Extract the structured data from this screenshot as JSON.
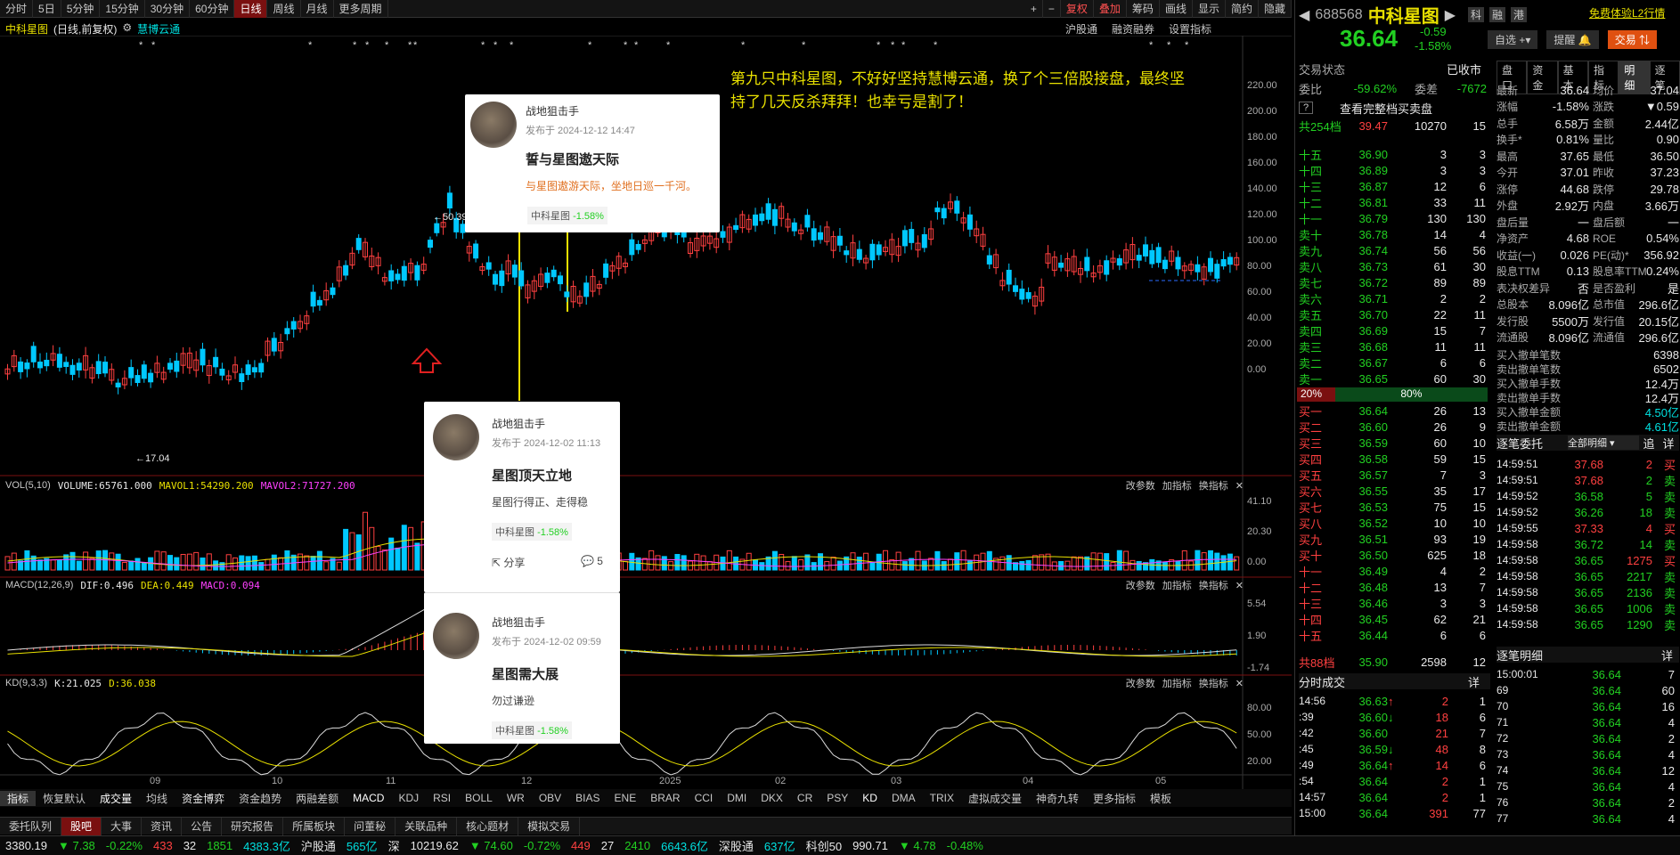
{
  "topbar": {
    "tabs": [
      "分时",
      "5日",
      "5分钟",
      "15分钟",
      "30分钟",
      "60分钟",
      "日线",
      "周线",
      "月线",
      "更多周期"
    ],
    "right": [
      "复权",
      "叠加",
      "筹码",
      "画线",
      "显示",
      "简约",
      "隐藏"
    ]
  },
  "chart_header": {
    "title": "中科星图",
    "sub": "(日线,前复权)",
    "overlay": "慧博云通",
    "right": [
      "沪股通",
      "融资融券",
      "设置指标"
    ]
  },
  "annotation": "第九只中科星图，不好好坚持慧博云通，换了个三倍股接盘，最终坚持了几天反杀拜拜！也幸亏是割了！",
  "price_marks": {
    "high": "50.39",
    "low": "17.04"
  },
  "price_axis": [
    "220.00",
    "200.00",
    "180.00",
    "160.00",
    "140.00",
    "120.00",
    "100.00",
    "80.00",
    "60.00",
    "40.00",
    "20.00",
    "0.00"
  ],
  "vol": {
    "label": "VOL(5,10)",
    "volume": "VOLUME:65761.000",
    "ma1": "MAVOL1:54290.200",
    "ma2": "MAVOL2:71727.200",
    "axis": [
      "41.10",
      "20.30",
      "0.00"
    ],
    "tools": [
      "改参数",
      "加指标",
      "换指标"
    ]
  },
  "macd": {
    "label": "MACD(12,26,9)",
    "dif": "DIF:0.496",
    "dea": "DEA:0.449",
    "macd": "MACD:0.094",
    "axis": [
      "5.54",
      "1.90",
      "-1.74"
    ]
  },
  "kd": {
    "label": "KD(9,3,3)",
    "k": "K:21.025",
    "d": "D:36.038",
    "axis": [
      "80.00",
      "50.00",
      "20.00"
    ]
  },
  "xaxis": [
    "09",
    "10",
    "11",
    "12",
    "2025",
    "02",
    "03",
    "04",
    "05"
  ],
  "indicator_bar": [
    "指标",
    "恢复默认",
    "成交量",
    "均线",
    "资金博弈",
    "资金趋势",
    "两融差额",
    "MACD",
    "KDJ",
    "RSI",
    "BOLL",
    "WR",
    "OBV",
    "BIAS",
    "ENE",
    "BRAR",
    "CCI",
    "DMI",
    "DKX",
    "CR",
    "PSY",
    "KD",
    "DMA",
    "TRIX",
    "虚拟成交量",
    "神奇九转",
    "更多指标",
    "模板"
  ],
  "bottom_tabs": [
    "委托队列",
    "股吧",
    "大事",
    "资讯",
    "公告",
    "研究报告",
    "所属板块",
    "问董秘",
    "关联品种",
    "核心题材",
    "模拟交易"
  ],
  "cards": [
    {
      "author": "战地狙击手",
      "date": "发布于 2024-12-12 14:47",
      "title": "誓与星图遨天际",
      "body": "与星图遨游天际，坐地日巡一千河。",
      "tag": "中科星图",
      "chg": "-1.58%"
    },
    {
      "author": "战地狙击手",
      "date": "发布于 2024-12-02 11:13",
      "title": "星图顶天立地",
      "body": "星图行得正、走得稳",
      "tag": "中科星图",
      "chg": "-1.58%",
      "share": "分享",
      "comments": "5"
    },
    {
      "author": "战地狙击手",
      "date": "发布于 2024-12-02 09:59",
      "title": "星图需大展",
      "body": "勿过谦逊",
      "tag": "中科星图",
      "chg": "-1.58%"
    }
  ],
  "quote": {
    "code": "688568",
    "name": "中科星图",
    "price": "36.64",
    "chg": "-0.59",
    "pct": "-1.58%",
    "btns": [
      "自选",
      "提醒",
      "交易"
    ],
    "top_right": [
      "科",
      "融",
      "港"
    ],
    "l2": "免费体验L2行情",
    "tabs": [
      "盘口",
      "资金",
      "基本",
      "指标",
      "明细",
      "逐笔"
    ],
    "state": "交易状态",
    "state_val": "已收市",
    "ratio": [
      "委比",
      "-59.62%",
      "委差",
      "-7672"
    ],
    "full": "查看完整档买卖盘",
    "sum": [
      "共254档",
      "39.47",
      "10270",
      "15"
    ],
    "asks": [
      [
        "十五",
        "36.90",
        "3",
        "3"
      ],
      [
        "十四",
        "36.89",
        "3",
        "3"
      ],
      [
        "十三",
        "36.87",
        "12",
        "6"
      ],
      [
        "十二",
        "36.81",
        "33",
        "11"
      ],
      [
        "十一",
        "36.79",
        "130",
        "130"
      ],
      [
        "卖十",
        "36.78",
        "14",
        "4"
      ],
      [
        "卖九",
        "36.74",
        "56",
        "56"
      ],
      [
        "卖八",
        "36.73",
        "61",
        "30"
      ],
      [
        "卖七",
        "36.72",
        "89",
        "89"
      ],
      [
        "卖六",
        "36.71",
        "2",
        "2"
      ],
      [
        "卖五",
        "36.70",
        "22",
        "11"
      ],
      [
        "卖四",
        "36.69",
        "15",
        "7"
      ],
      [
        "卖三",
        "36.68",
        "11",
        "11"
      ],
      [
        "卖二",
        "36.67",
        "6",
        "6"
      ],
      [
        "卖一",
        "36.65",
        "60",
        "30"
      ]
    ],
    "bar": [
      "20%",
      "80%"
    ],
    "bids": [
      [
        "买一",
        "36.64",
        "26",
        "13"
      ],
      [
        "买二",
        "36.60",
        "26",
        "9"
      ],
      [
        "买三",
        "36.59",
        "60",
        "10"
      ],
      [
        "买四",
        "36.58",
        "59",
        "15"
      ],
      [
        "买五",
        "36.57",
        "7",
        "3"
      ],
      [
        "买六",
        "36.55",
        "35",
        "17"
      ],
      [
        "买七",
        "36.53",
        "75",
        "15"
      ],
      [
        "买八",
        "36.52",
        "10",
        "10"
      ],
      [
        "买九",
        "36.51",
        "93",
        "19"
      ],
      [
        "买十",
        "36.50",
        "625",
        "18"
      ],
      [
        "十一",
        "36.49",
        "4",
        "2"
      ],
      [
        "十二",
        "36.48",
        "13",
        "7"
      ],
      [
        "十三",
        "36.46",
        "3",
        "3"
      ],
      [
        "十四",
        "36.45",
        "62",
        "21"
      ],
      [
        "十五",
        "36.44",
        "6",
        "6"
      ]
    ],
    "bsum": [
      "共88档",
      "35.90",
      "2598",
      "12"
    ],
    "stats": [
      [
        "最新",
        "36.64",
        "均价",
        "37.04"
      ],
      [
        "涨幅",
        "-1.58%",
        "涨跌",
        "▼0.59"
      ],
      [
        "总手",
        "6.58万",
        "金额",
        "2.44亿"
      ],
      [
        "换手*",
        "0.81%",
        "量比",
        "0.90"
      ],
      [
        "最高",
        "37.65",
        "最低",
        "36.50"
      ],
      [
        "今开",
        "37.01",
        "昨收",
        "37.23"
      ],
      [
        "涨停",
        "44.68",
        "跌停",
        "29.78"
      ],
      [
        "外盘",
        "2.92万",
        "内盘",
        "3.66万"
      ],
      [
        "盘后量",
        "一",
        "盘后额",
        "一"
      ],
      [
        "净资产",
        "4.68",
        "ROE",
        "0.54%"
      ],
      [
        "收益(一)",
        "0.026",
        "PE(动)*",
        "356.92"
      ],
      [
        "股息TTM",
        "0.13",
        "股息率TTM",
        "0.24%"
      ],
      [
        "表决权差异",
        "否",
        "是否盈利",
        "是"
      ],
      [
        "总股本",
        "8.096亿",
        "总市值",
        "296.6亿"
      ],
      [
        "发行股",
        "5500万",
        "发行值",
        "20.15亿"
      ],
      [
        "流通股",
        "8.096亿",
        "流通值",
        "296.6亿"
      ]
    ],
    "cancel": [
      [
        "买入撤单笔数",
        "6398"
      ],
      [
        "卖出撤单笔数",
        "6502"
      ],
      [
        "买入撤单手数",
        "12.4万"
      ],
      [
        "卖出撤单手数",
        "12.4万"
      ],
      [
        "买入撤单金额",
        "4.50亿"
      ],
      [
        "卖出撤单金额",
        "4.61亿"
      ]
    ],
    "zb_title": "逐笔委托",
    "zb_sel": "全部明细",
    "zb_btns": [
      "追",
      "详"
    ],
    "zb": [
      [
        "14:59:51",
        "37.68",
        "2",
        "买"
      ],
      [
        "14:59:51",
        "37.68",
        "2",
        "卖"
      ],
      [
        "14:59:52",
        "36.58",
        "5",
        "卖"
      ],
      [
        "14:59:52",
        "36.26",
        "18",
        "卖"
      ],
      [
        "14:59:55",
        "37.33",
        "4",
        "买"
      ],
      [
        "14:59:58",
        "36.72",
        "14",
        "卖"
      ],
      [
        "14:59:58",
        "36.65",
        "1275",
        "买"
      ],
      [
        "14:59:58",
        "36.65",
        "2217",
        "卖"
      ],
      [
        "14:59:58",
        "36.65",
        "2136",
        "卖"
      ],
      [
        "14:59:58",
        "36.65",
        "1006",
        "卖"
      ],
      [
        "14:59:58",
        "36.65",
        "1290",
        "卖"
      ]
    ],
    "fs_title": "分时成交",
    "fs_btn": "详",
    "fs": [
      [
        "14:56",
        "36.63",
        "↑",
        "2",
        "1"
      ],
      [
        ":39",
        "36.60",
        "↓",
        "18",
        "6"
      ],
      [
        ":42",
        "36.60",
        "",
        "21",
        "7"
      ],
      [
        ":45",
        "36.59",
        "↓",
        "48",
        "8"
      ],
      [
        ":49",
        "36.64",
        "↑",
        "14",
        "6"
      ],
      [
        ":54",
        "36.64",
        "",
        "2",
        "1"
      ],
      [
        "14:57",
        "36.64",
        "",
        "2",
        "1"
      ],
      [
        "15:00",
        "36.64",
        "",
        "391",
        "77"
      ]
    ],
    "mx_title": "逐笔明细",
    "mx_btn": "详",
    "mx": [
      [
        "15:00:01",
        "36.64",
        "7"
      ],
      [
        "69",
        "36.64",
        "60"
      ],
      [
        "70",
        "36.64",
        "16"
      ],
      [
        "71",
        "36.64",
        "4"
      ],
      [
        "72",
        "36.64",
        "2"
      ],
      [
        "73",
        "36.64",
        "4"
      ],
      [
        "74",
        "36.64",
        "12"
      ],
      [
        "75",
        "36.64",
        "4"
      ],
      [
        "76",
        "36.64",
        "2"
      ],
      [
        "77",
        "36.64",
        "4"
      ]
    ]
  },
  "status": {
    "a": "3380.19",
    "a2": "▼ 7.38",
    "a3": "-0.22%",
    "a4": "433",
    "a5": "32",
    "a6": "1851",
    "a7": "4383.3亿",
    "hgt": "沪股通",
    "hgt_v": "565亿",
    "sz": "深",
    "sz1": "10219.62",
    "sz2": "▼ 74.60",
    "sz3": "-0.72%",
    "sz4": "449",
    "sz5": "27",
    "sz6": "2410",
    "sz7": "6643.6亿",
    "sgt": "深股通",
    "sgt_v": "637亿",
    "kc": "科创50",
    "kc1": "990.71",
    "kc2": "▼ 4.78",
    "kc3": "-0.48%"
  }
}
